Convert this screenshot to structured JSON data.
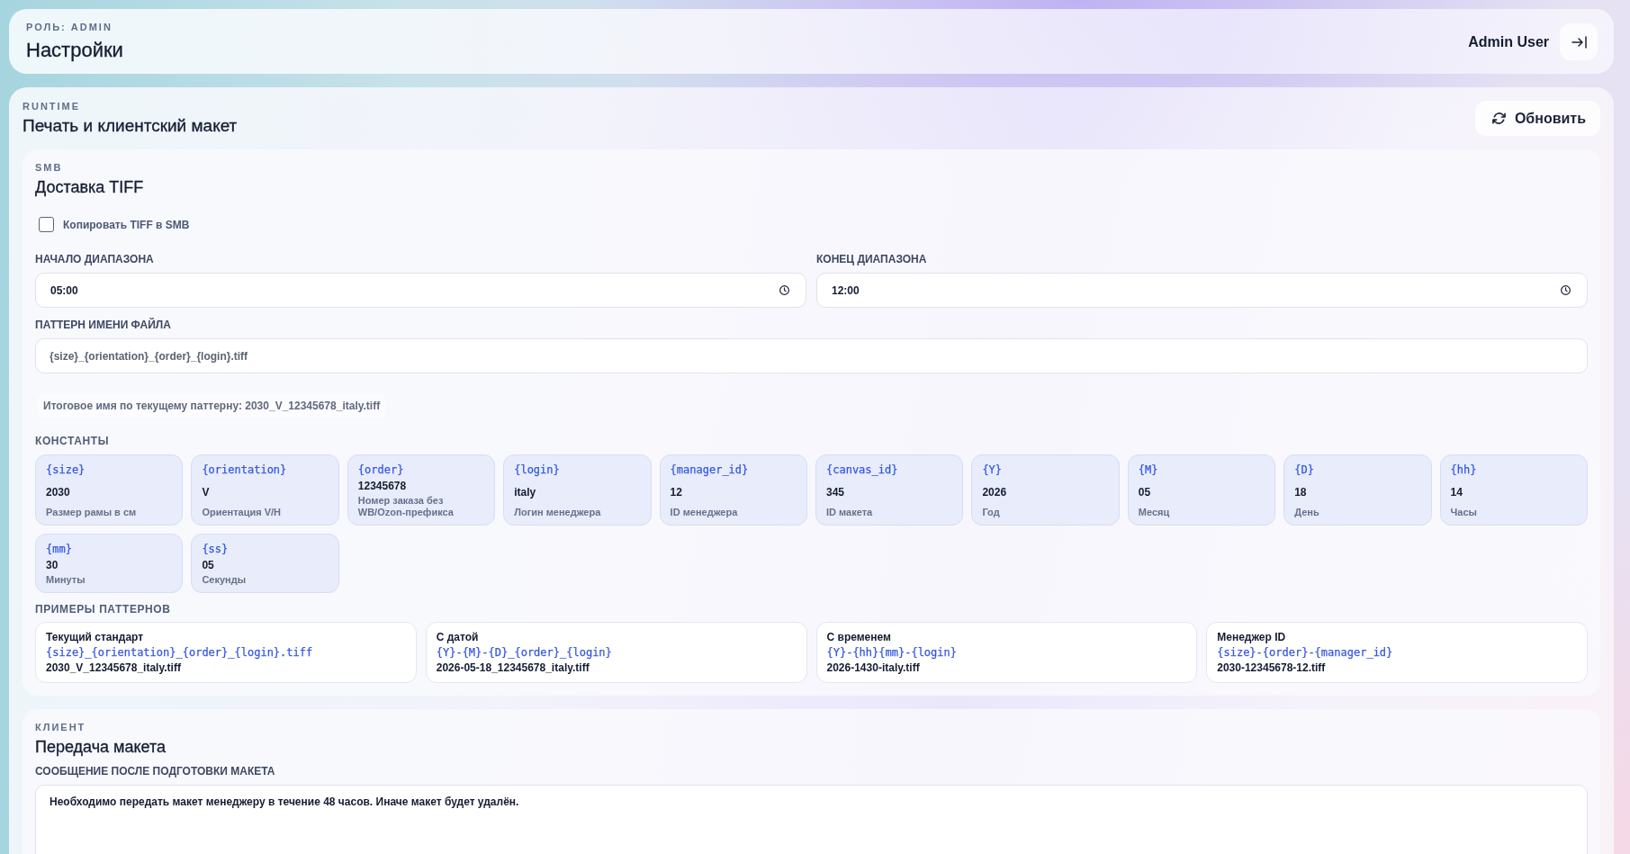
{
  "header": {
    "role": "РОЛЬ: ADMIN",
    "title": "Настройки",
    "user": "Admin User"
  },
  "section": {
    "eyebrow": "RUNTIME",
    "title": "Печать и клиентский макет",
    "refresh_button": "Обновить"
  },
  "smb": {
    "eyebrow": "SMB",
    "title": "Доставка TIFF",
    "copy_checkbox": {
      "label": "Копировать TIFF в SMB",
      "checked": false
    },
    "range_start": {
      "label": "НАЧАЛО ДИАПАЗОНА",
      "value": "05:00"
    },
    "range_end": {
      "label": "КОНЕЦ ДИАПАЗОНА",
      "value": "12:00"
    },
    "filename_pattern": {
      "label": "ПАТТЕРН ИМЕНИ ФАЙЛА",
      "value": "{size}_{orientation}_{order}_{login}.tiff"
    },
    "result_hint": "Итоговое имя по текущему паттерну: 2030_V_12345678_italy.tiff",
    "constants_label": "КОНСТАНТЫ",
    "constants": [
      {
        "key": "{size}",
        "value": "2030",
        "description": "Размер рамы в см"
      },
      {
        "key": "{orientation}",
        "value": "V",
        "description": "Ориентация V/H"
      },
      {
        "key": "{order}",
        "value": "12345678",
        "description": "Номер заказа без WB/Ozon-префикса"
      },
      {
        "key": "{login}",
        "value": "italy",
        "description": "Логин менеджера"
      },
      {
        "key": "{manager_id}",
        "value": "12",
        "description": "ID менеджера"
      },
      {
        "key": "{canvas_id}",
        "value": "345",
        "description": "ID макета"
      },
      {
        "key": "{Y}",
        "value": "2026",
        "description": "Год"
      },
      {
        "key": "{M}",
        "value": "05",
        "description": "Месяц"
      },
      {
        "key": "{D}",
        "value": "18",
        "description": "День"
      },
      {
        "key": "{hh}",
        "value": "14",
        "description": "Часы"
      },
      {
        "key": "{mm}",
        "value": "30",
        "description": "Минуты"
      },
      {
        "key": "{ss}",
        "value": "05",
        "description": "Секунды"
      }
    ],
    "examples_label": "ПРИМЕРЫ ПАТТЕРНОВ",
    "examples": [
      {
        "title": "Текущий стандарт",
        "pattern": "{size}_{orientation}_{order}_{login}.tiff",
        "result": "2030_V_12345678_italy.tiff"
      },
      {
        "title": "С датой",
        "pattern": "{Y}-{M}-{D}_{order}_{login}",
        "result": "2026-05-18_12345678_italy.tiff"
      },
      {
        "title": "С временем",
        "pattern": "{Y}-{hh}{mm}-{login}",
        "result": "2026-1430-italy.tiff"
      },
      {
        "title": "Менеджер ID",
        "pattern": "{size}-{order}-{manager_id}",
        "result": "2030-12345678-12.tiff"
      }
    ]
  },
  "client": {
    "eyebrow": "КЛИЕНТ",
    "title": "Передача макета",
    "message": {
      "label": "СООБЩЕНИЕ ПОСЛЕ ПОДГОТОВКИ МАКЕТА",
      "value": "Необходимо передать макет менеджеру в течение 48 часов. Иначе макет будет удалён."
    }
  }
}
